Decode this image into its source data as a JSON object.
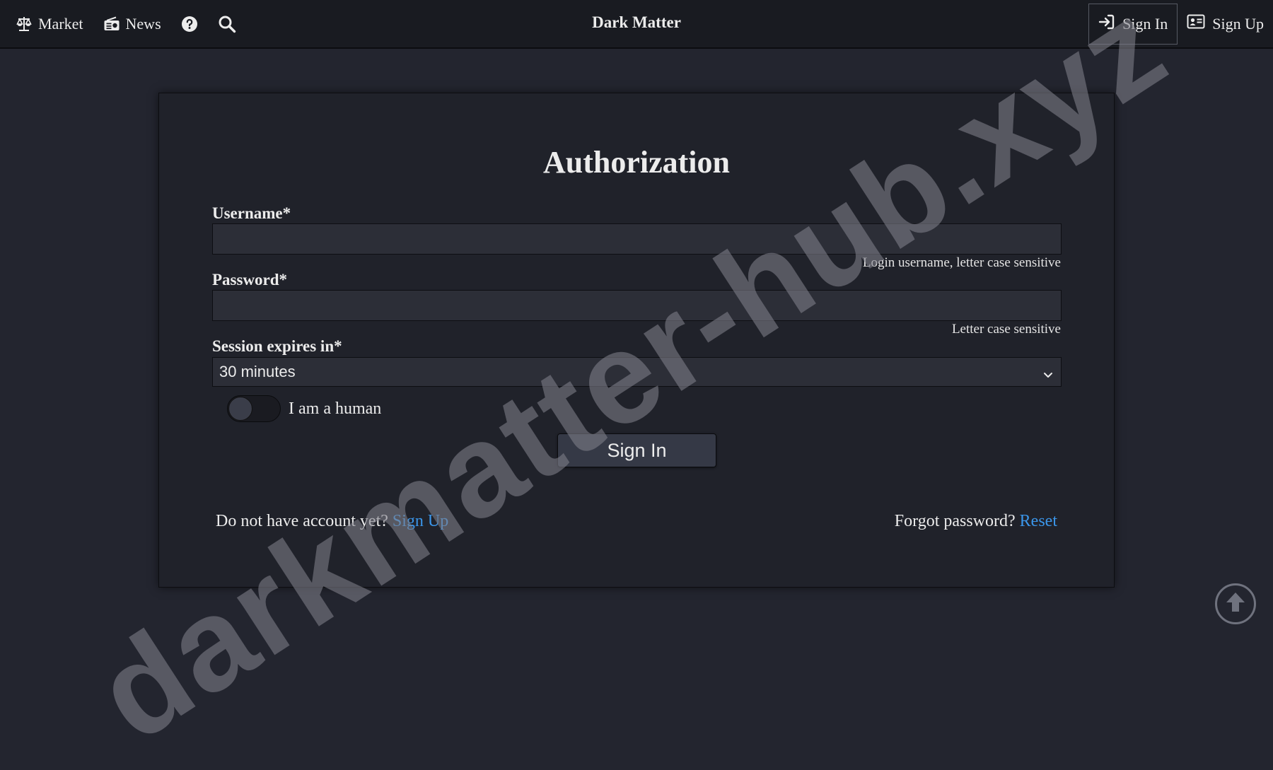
{
  "nav": {
    "market": {
      "label": "Market",
      "icon": "scale-icon"
    },
    "news": {
      "label": "News",
      "icon": "radio-icon"
    },
    "help": {
      "icon": "question-circle-icon"
    },
    "search": {
      "icon": "search-icon"
    },
    "brand": "Dark Matter",
    "sign_in": {
      "label": "Sign In",
      "icon": "sign-in-icon",
      "active": true
    },
    "sign_up": {
      "label": "Sign Up",
      "icon": "id-card-icon"
    }
  },
  "form": {
    "title": "Authorization",
    "username": {
      "label": "Username*",
      "value": "",
      "hint": "Login username, letter case sensitive"
    },
    "password": {
      "label": "Password*",
      "value": "",
      "hint": "Letter case sensitive"
    },
    "session": {
      "label": "Session expires in*",
      "selected": "30 minutes"
    },
    "human_toggle": {
      "label": "I am a human",
      "checked": false
    },
    "submit_label": "Sign In"
  },
  "footer": {
    "no_account_text": "Do not have account yet?",
    "sign_up_link": "Sign Up",
    "forgot_text": "Forgot password?",
    "reset_link": "Reset"
  },
  "watermark": "darkmatter-hub.xyz",
  "scroll_top": {
    "icon": "arrow-up-circle-icon"
  },
  "colors": {
    "background": "#23252f",
    "navbar": "#191b21",
    "panel": "#20222a",
    "link": "#3b96ea",
    "text": "#ececec"
  }
}
